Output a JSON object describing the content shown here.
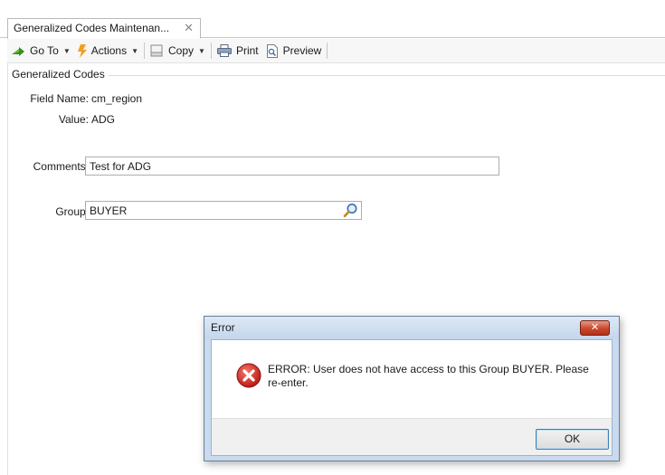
{
  "tab": {
    "title": "Generalized Codes Maintenan...",
    "close_glyph": "✕"
  },
  "toolbar": {
    "goto_label": "Go To",
    "actions_label": "Actions",
    "copy_label": "Copy",
    "print_label": "Print",
    "preview_label": "Preview",
    "dropdown_glyph": "▼"
  },
  "form": {
    "section_title": "Generalized Codes",
    "field_name_label": "Field Name:",
    "field_name_value": "cm_region",
    "value_label": "Value:",
    "value_value": "ADG",
    "comments_label": "Comments:",
    "comments_value": "Test for ADG",
    "group_label": "Group:",
    "group_value": "BUYER"
  },
  "dialog": {
    "title": "Error",
    "close_glyph": "✕",
    "message": "ERROR: User does not have access to this Group BUYER.  Please re-enter.",
    "ok_label": "OK"
  },
  "icons": {
    "goto": "green-arrow-icon",
    "actions": "lightning-icon",
    "copy": "copy-icon",
    "print": "printer-icon",
    "preview": "preview-icon",
    "lookup": "magnifier-icon",
    "error": "error-icon"
  },
  "colors": {
    "error_red": "#d21f1f",
    "dialog_frame": "#c9daee",
    "ok_border": "#3c7fb1"
  }
}
